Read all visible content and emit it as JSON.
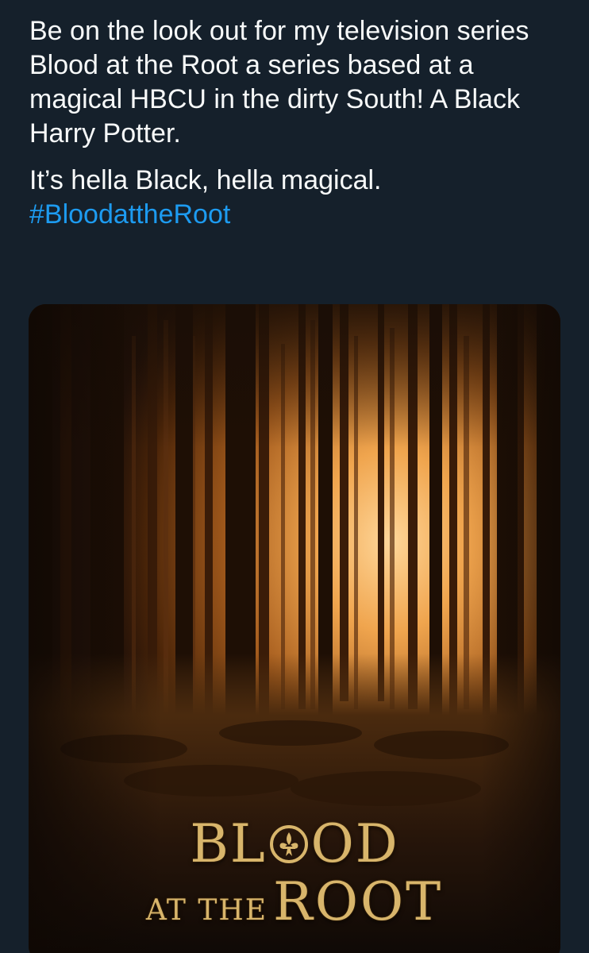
{
  "tweet": {
    "paragraph1": "Be on the look out for my television series Blood at the Root a series based at a magical HBCU in the dirty South! A Black Harry Potter.",
    "paragraph2": "It’s hella Black, hella magical.",
    "hashtag": "#BloodattheRoot",
    "hashtag_color": "#1d9bf0",
    "text_color": "#f7f9f9",
    "background_color": "#15202b"
  },
  "poster": {
    "title_part1": "BL",
    "title_emblem": "fleur-de-lis",
    "title_part2": "OD",
    "title_at_the": "AT THE",
    "title_root": "ROOT",
    "title_color": "#d8b56b"
  }
}
